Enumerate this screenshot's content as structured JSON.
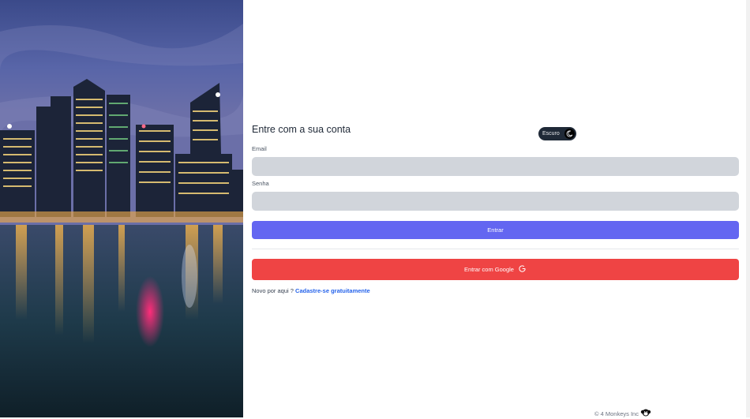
{
  "hero": {
    "image": "singapore-skyline-night-reflection"
  },
  "login": {
    "title": "Entre com a sua conta",
    "theme_toggle_label": "Escuro",
    "theme_icon": "moon-icon",
    "email_label": "Email",
    "email_value": "",
    "password_label": "Senha",
    "password_value": "",
    "submit_label": "Entrar",
    "google_label": "Entrar com Google",
    "google_icon": "google-g-icon",
    "signup_prefix": "Novo por aqui ?",
    "signup_link": "Cadastre-se gratuitamente"
  },
  "footer": {
    "text": "© 4 Monkeys Inc",
    "logo_icon": "monkey-icon"
  },
  "colors": {
    "primary": "#6366f1",
    "google": "#ef4444",
    "link": "#2563eb",
    "input_bg": "#d1d5db",
    "toggle_bg": "#1f2937"
  }
}
